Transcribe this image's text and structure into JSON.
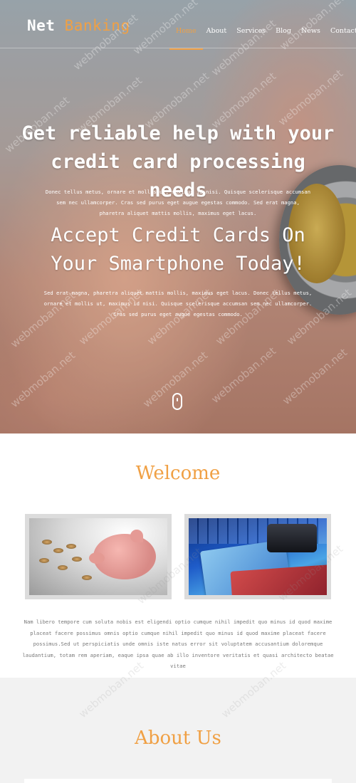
{
  "brand": {
    "word1": "Net",
    "word2": "Banking"
  },
  "nav": [
    {
      "label": "Home",
      "active": true
    },
    {
      "label": "About"
    },
    {
      "label": "Services"
    },
    {
      "label": "Blog"
    },
    {
      "label": "News"
    },
    {
      "label": "Contact"
    }
  ],
  "hero": {
    "headline1": "Get reliable help with your credit card processing needs",
    "text1": "Donec tellus metus, ornare et mollis ut, maximus id nisi. Quisque scelerisque accumsan sem nec ullamcorper. Cras sed purus eget augue egestas commodo. Sed erat magna, pharetra aliquet mattis mollis, maximus eget lacus.",
    "headline2": "Accept Credit Cards On Your Smartphone Today!",
    "text2": "Sed erat magna, pharetra aliquet mattis mollis, maximus eget lacus. Donec tellus metus, ornare et mollis ut, maximus id nisi. Quisque scelerisque accumsan sem nec ullamcorper. Cras sed purus eget augue egestas commodo."
  },
  "welcome": {
    "title": "Welcome",
    "text": "Nam libero tempore cum soluta nobis est eligendi optio cumque nihil impedit quo minus id quod maxime placeat facere possimus omnis optio cumque nihil impedit quo minus id quod maxime placeat facere possimus.Sed ut perspiciatis unde omnis iste natus error sit voluptatem accusantium doloremque laudantium, totam rem aperiam, eaque ipsa quae ab illo inventore veritatis et quasi architecto beatae vitae"
  },
  "about": {
    "title": "About Us"
  },
  "watermark": "webmoban.net",
  "colors": {
    "accent": "#f0a044",
    "about_bg": "#f2f2f2"
  }
}
